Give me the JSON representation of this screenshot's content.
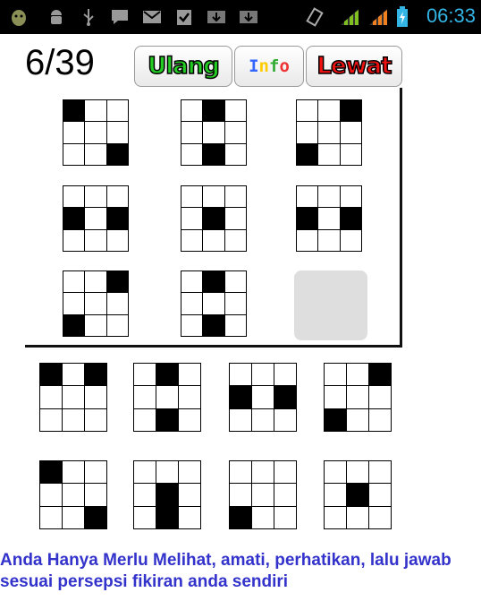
{
  "status_bar": {
    "time": "06:33",
    "icons": [
      "android-debug-icon",
      "android-icon",
      "usb-icon",
      "bbm-icon",
      "gmail-icon",
      "task-check-icon",
      "download-icon",
      "download-icon",
      "vibrate-icon",
      "wifi-signal-icon",
      "cell-signal-icon",
      "battery-charging-icon"
    ]
  },
  "header": {
    "progress": "6/39",
    "buttons": {
      "retry": "Ulang",
      "info": "Info",
      "skip": "Lewat"
    },
    "colors": {
      "retry": "#22cc22",
      "info_i": "#3366ff",
      "info_n": "#ffcc00",
      "info_f": "#33aa33",
      "info_o": "#ee3333",
      "skip": "#ee1111"
    }
  },
  "puzzle": {
    "tiles": [
      [
        1,
        0,
        0,
        0,
        0,
        0,
        0,
        0,
        1
      ],
      [
        0,
        1,
        0,
        0,
        0,
        0,
        0,
        1,
        0
      ],
      [
        0,
        0,
        1,
        0,
        0,
        0,
        1,
        0,
        0
      ],
      [
        0,
        0,
        0,
        1,
        0,
        1,
        0,
        0,
        0
      ],
      [
        0,
        0,
        0,
        0,
        1,
        0,
        0,
        0,
        0
      ],
      [
        0,
        0,
        0,
        1,
        0,
        1,
        0,
        0,
        0
      ],
      [
        0,
        0,
        1,
        0,
        0,
        0,
        1,
        0,
        0
      ],
      [
        0,
        1,
        0,
        0,
        0,
        0,
        0,
        1,
        0
      ]
    ]
  },
  "answers": {
    "tiles": [
      [
        1,
        0,
        1,
        0,
        0,
        0,
        0,
        0,
        0
      ],
      [
        0,
        1,
        0,
        0,
        0,
        0,
        0,
        1,
        0
      ],
      [
        0,
        0,
        0,
        1,
        0,
        1,
        0,
        0,
        0
      ],
      [
        0,
        0,
        1,
        0,
        0,
        0,
        1,
        0,
        0
      ],
      [
        1,
        0,
        0,
        0,
        0,
        0,
        0,
        0,
        1
      ],
      [
        0,
        0,
        0,
        0,
        1,
        0,
        0,
        1,
        0
      ],
      [
        0,
        0,
        0,
        0,
        0,
        0,
        1,
        0,
        0
      ],
      [
        0,
        0,
        0,
        0,
        1,
        0,
        0,
        0,
        0
      ]
    ]
  },
  "hint": {
    "line1": "Anda Hanya Merlu Melihat, amati, perhatikan, lalu jawab",
    "line2": "sesuai persepsi fikiran anda sendiri"
  }
}
